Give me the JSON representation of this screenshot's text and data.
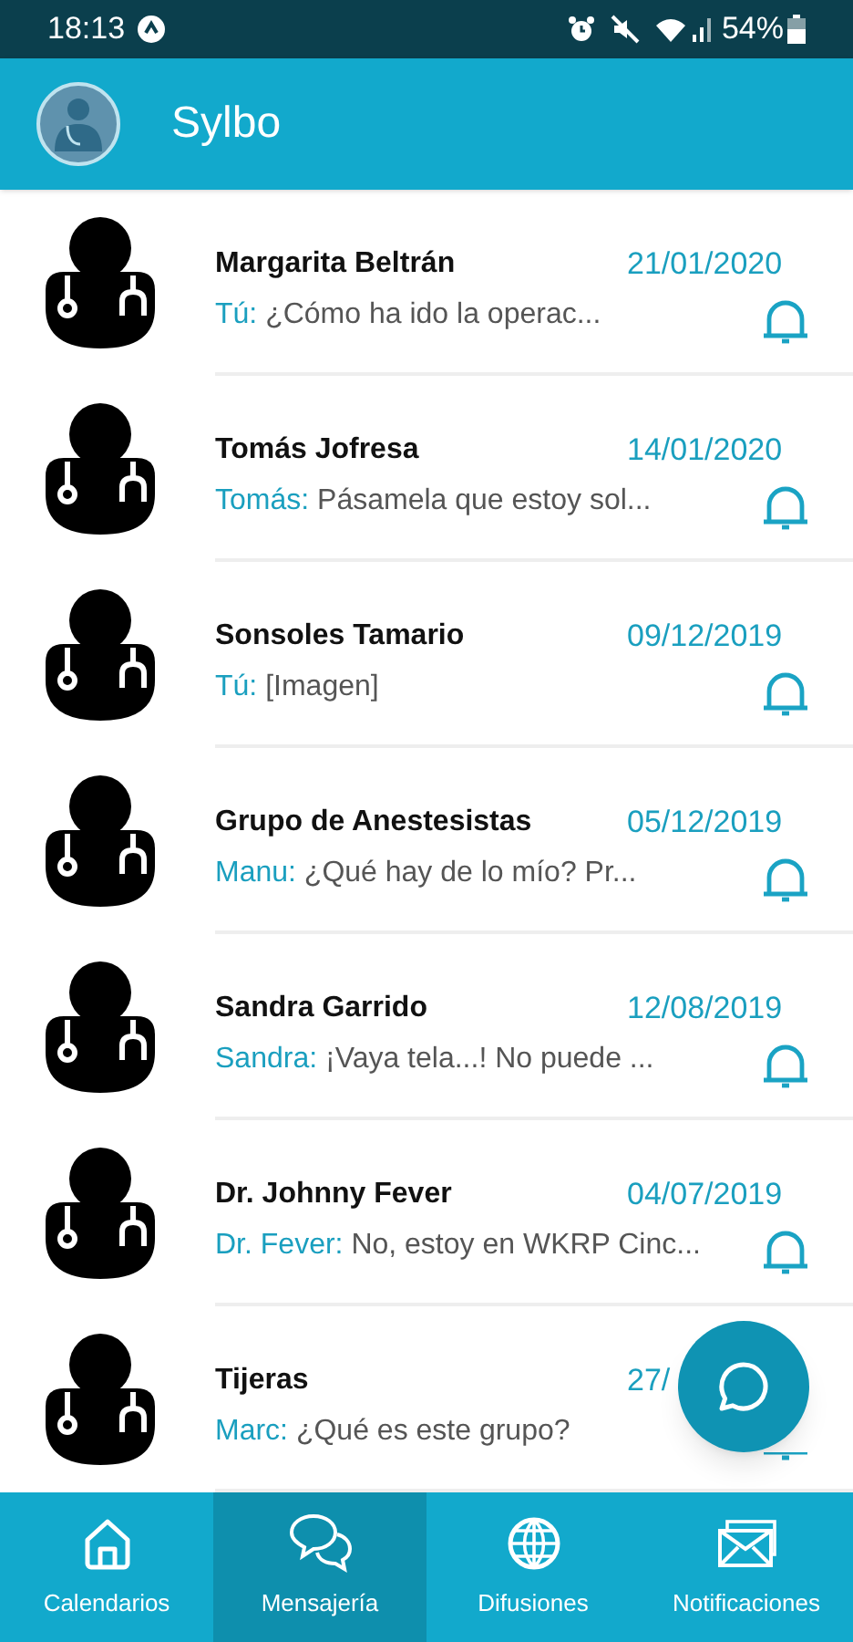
{
  "status_bar": {
    "time": "18:13",
    "battery": "54%"
  },
  "app_bar": {
    "title": "Sylbo"
  },
  "chats": [
    {
      "name": "Margarita Beltrán",
      "date": "21/01/2020",
      "sender": "Tú:",
      "preview": "¿Cómo ha ido la operac..."
    },
    {
      "name": "Tomás Jofresa",
      "date": "14/01/2020",
      "sender": "Tomás:",
      "preview": "Pásamela que estoy sol..."
    },
    {
      "name": "Sonsoles Tamario",
      "date": "09/12/2019",
      "sender": "Tú:",
      "preview": "[Imagen]"
    },
    {
      "name": "Grupo de Anestesistas",
      "date": "05/12/2019",
      "sender": "Manu:",
      "preview": "¿Qué hay de lo mío? Pr..."
    },
    {
      "name": "Sandra Garrido",
      "date": "12/08/2019",
      "sender": "Sandra:",
      "preview": "¡Vaya tela...! No puede ..."
    },
    {
      "name": "Dr. Johnny Fever",
      "date": "04/07/2019",
      "sender": "Dr. Fever:",
      "preview": "No, estoy en WKRP Cinc..."
    },
    {
      "name": "Tijeras",
      "date": "27/",
      "sender": "Marc:",
      "preview": "¿Qué es este grupo?"
    }
  ],
  "nav": [
    {
      "label": "Calendarios",
      "kind": "home",
      "selected": false
    },
    {
      "label": "Mensajería",
      "kind": "chat",
      "selected": true
    },
    {
      "label": "Difusiones",
      "kind": "globe",
      "selected": false
    },
    {
      "label": "Notificaciones",
      "kind": "mail",
      "selected": false
    }
  ]
}
